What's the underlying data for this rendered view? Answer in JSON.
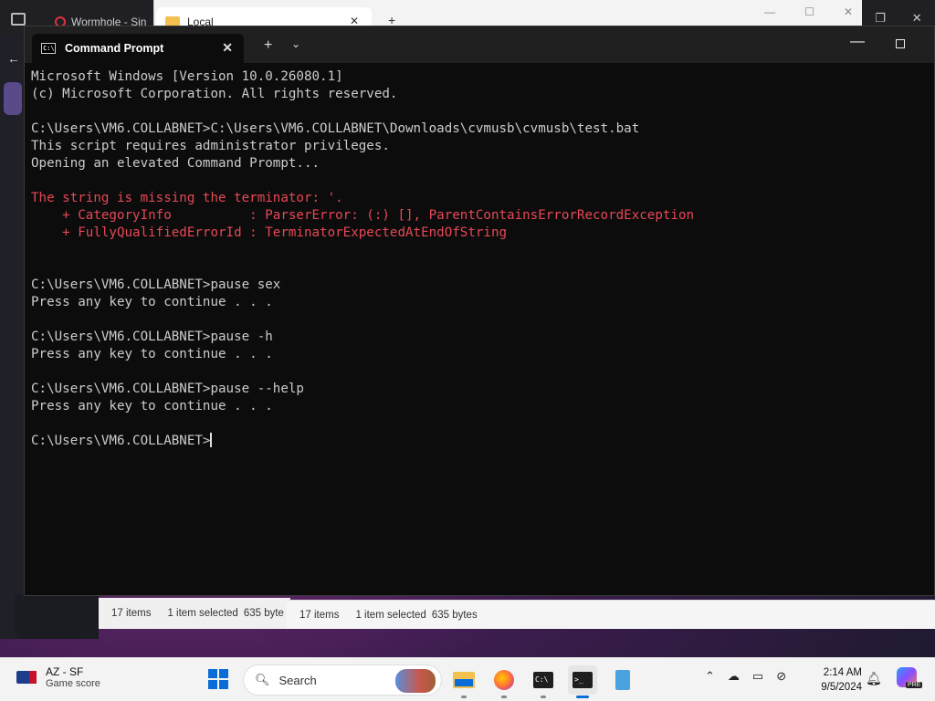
{
  "background": {
    "browser_tab_title": "Wormhole - Sin",
    "explorer_tab_title": "Local",
    "explorer_status_1": {
      "items": "17 items",
      "selected": "1 item selected",
      "size": "635 byte"
    },
    "explorer_status_2": {
      "items": "17 items",
      "selected": "1 item selected",
      "size": "635 bytes"
    }
  },
  "window": {
    "tab_title": "Command Prompt",
    "new_tab_label": "+",
    "dropdown_label": "⌄",
    "minimize_label": "—",
    "close_tab_label": "✕"
  },
  "terminal": {
    "lines": [
      {
        "text": "Microsoft Windows [Version 10.0.26080.1]",
        "style": "normal"
      },
      {
        "text": "(c) Microsoft Corporation. All rights reserved.",
        "style": "normal"
      },
      {
        "text": "",
        "style": "normal"
      },
      {
        "text": "C:\\Users\\VM6.COLLABNET>C:\\Users\\VM6.COLLABNET\\Downloads\\cvmusb\\cvmusb\\test.bat",
        "style": "normal"
      },
      {
        "text": "This script requires administrator privileges.",
        "style": "normal"
      },
      {
        "text": "Opening an elevated Command Prompt...",
        "style": "normal"
      },
      {
        "text": "",
        "style": "normal"
      },
      {
        "text": "The string is missing the terminator: '.",
        "style": "error"
      },
      {
        "text": "    + CategoryInfo          : ParserError: (:) [], ParentContainsErrorRecordException",
        "style": "error"
      },
      {
        "text": "    + FullyQualifiedErrorId : TerminatorExpectedAtEndOfString",
        "style": "error"
      },
      {
        "text": "",
        "style": "normal"
      },
      {
        "text": "",
        "style": "normal"
      },
      {
        "text": "C:\\Users\\VM6.COLLABNET>pause sex",
        "style": "normal"
      },
      {
        "text": "Press any key to continue . . .",
        "style": "normal"
      },
      {
        "text": "",
        "style": "normal"
      },
      {
        "text": "C:\\Users\\VM6.COLLABNET>pause -h",
        "style": "normal"
      },
      {
        "text": "Press any key to continue . . .",
        "style": "normal"
      },
      {
        "text": "",
        "style": "normal"
      },
      {
        "text": "C:\\Users\\VM6.COLLABNET>pause --help",
        "style": "normal"
      },
      {
        "text": "Press any key to continue . . .",
        "style": "normal"
      },
      {
        "text": "",
        "style": "normal"
      }
    ],
    "prompt": "C:\\Users\\VM6.COLLABNET>"
  },
  "taskbar": {
    "widget_title": "AZ - SF",
    "widget_subtitle": "Game score",
    "search_placeholder": "Search",
    "clock_time": "2:14 AM",
    "clock_date": "9/5/2024",
    "copilot_badge": "PRE",
    "apps": [
      "file-explorer",
      "firefox",
      "command-prompt",
      "terminal",
      "notepad"
    ]
  },
  "colors": {
    "terminal_bg": "#0c0c0c",
    "terminal_text": "#cccccc",
    "error_text": "#e74856",
    "taskbar_bg": "#f3f3f3",
    "accent": "#0a6cd6"
  }
}
